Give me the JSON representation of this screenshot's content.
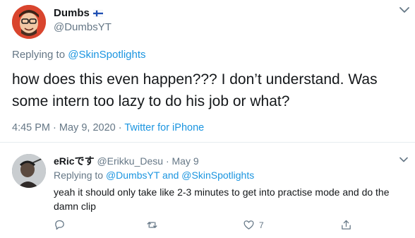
{
  "tweet": {
    "display_name": "Dumbs",
    "handle": "@DumbsYT",
    "replying_prefix": "Replying to",
    "replying_mention": "@SkinSpotlights",
    "text": "how does this even happen??? I don’t understand. Was some intern too lazy to do his job or what?",
    "time": "4:45 PM",
    "sep": "·",
    "date": "May 9, 2020",
    "source": "Twitter for iPhone"
  },
  "reply": {
    "display_name": "eRicです",
    "handle": "@Erikku_Desu",
    "sep": "·",
    "date": "May 9",
    "replying_prefix": "Replying to",
    "mention_1": "@DumbsYT",
    "and": "and",
    "mention_2": "@SkinSpotlights",
    "text": "yeah it should only take like 2-3 minutes to get into practise mode and do the damn clip",
    "like_count": "7"
  },
  "colors": {
    "link": "#1b95e0",
    "muted": "#657786",
    "text": "#14171a",
    "border": "#e6ecf0"
  },
  "icons": {
    "flag": "finland-flag-icon",
    "reply": "reply-icon",
    "retweet": "retweet-icon",
    "like": "heart-icon",
    "share": "share-icon",
    "more": "more-icon"
  }
}
